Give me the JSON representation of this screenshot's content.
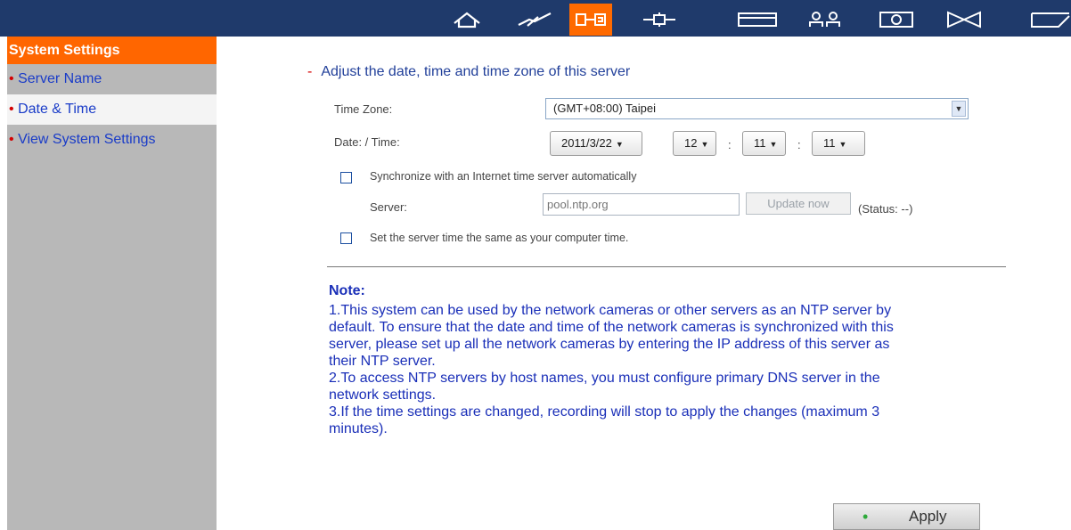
{
  "topbar": {
    "icons": [
      "home-icon",
      "flash-icon",
      "server-settings-icon",
      "network-icon",
      "storage-icon",
      "users-icon",
      "camera-icon",
      "services-icon",
      "tools-icon"
    ],
    "active_icon": "server-settings-icon"
  },
  "sidebar": {
    "title": "System Settings",
    "items": [
      {
        "label": "Server Name"
      },
      {
        "label": "Date & Time"
      },
      {
        "label": "View System Settings"
      }
    ],
    "bullet": "•"
  },
  "main": {
    "section_title": "Adjust the date, time and time zone of this server",
    "section_dash": "-",
    "time_zone": {
      "label": "Time Zone:",
      "value": "(GMT+08:00) Taipei"
    },
    "date_time": {
      "label": "Date: / Time:",
      "date": "2011/3/22",
      "hour": "12",
      "minute": "11",
      "second": "11",
      "separator": ":"
    },
    "sync": {
      "label": "Synchronize with an Internet time server automatically",
      "checked": false
    },
    "server": {
      "label": "Server:",
      "placeholder": "pool.ntp.org",
      "update_button": "Update now",
      "status": "(Status: --)"
    },
    "computer_time": {
      "label": "Set the server time the same as your computer time.",
      "checked": false
    },
    "note": {
      "title": "Note:",
      "lines": [
        "1.This system can be used by the network cameras or other servers as an NTP server by",
        "default. To ensure that the date and time of the network cameras is synchronized with this",
        "server, please set up all the network cameras by entering the IP address of this server as",
        "their NTP server.",
        "2.To access NTP servers by host names, you must configure primary DNS server in the",
        "network settings.",
        "3.If the time settings are changed, recording will stop to apply the changes (maximum 3",
        "minutes)."
      ]
    },
    "apply_button": "Apply",
    "apply_dot": "•"
  },
  "colors": {
    "topbar": "#1f3a6b",
    "accent": "#ff6600",
    "sidebar_bg": "#b8b8b8",
    "link_blue": "#1a3cc8",
    "bullet_red": "#d40000",
    "note_blue": "#1a2fb8"
  }
}
